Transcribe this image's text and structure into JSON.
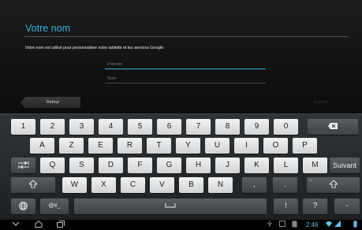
{
  "setup": {
    "title": "Votre nom",
    "subtitle": "Votre nom est utilisé pour personnaliser votre tablette et les services Google.",
    "first_name_placeholder": "Prénom",
    "last_name_placeholder": "Nom",
    "back_label": "Retour",
    "next_label": "Suivant"
  },
  "keyboard": {
    "row1": [
      "1",
      "2",
      "3",
      "4",
      "5",
      "6",
      "7",
      "8",
      "9",
      "0"
    ],
    "row2": [
      "A",
      "Z",
      "E",
      "R",
      "T",
      "Y",
      "U",
      "I",
      "O",
      "P"
    ],
    "row3": [
      "Q",
      "S",
      "D",
      "F",
      "G",
      "H",
      "J",
      "K",
      "L",
      "M"
    ],
    "row4": [
      "W",
      "X",
      "C",
      "V",
      "B",
      "N",
      ",",
      "."
    ],
    "row3_action": "Suivant",
    "symbols": "@#_",
    "excl": "!",
    "question": "?",
    "dash": "-",
    "hint_dot": ".",
    "hint_at": "@"
  },
  "icons": {
    "backspace": "backspace-icon",
    "shift": "shift-icon",
    "tab": "tab-icon",
    "globe": "globe-icon",
    "space": "spacebar-icon",
    "nav_back": "back-nav-icon",
    "nav_home": "home-nav-icon",
    "nav_recent": "recent-apps-icon"
  },
  "status": {
    "time": "2:46"
  },
  "colors": {
    "accent": "#35b5e5",
    "key_light": "#e8e8e8",
    "key_dark": "#4a5054"
  }
}
